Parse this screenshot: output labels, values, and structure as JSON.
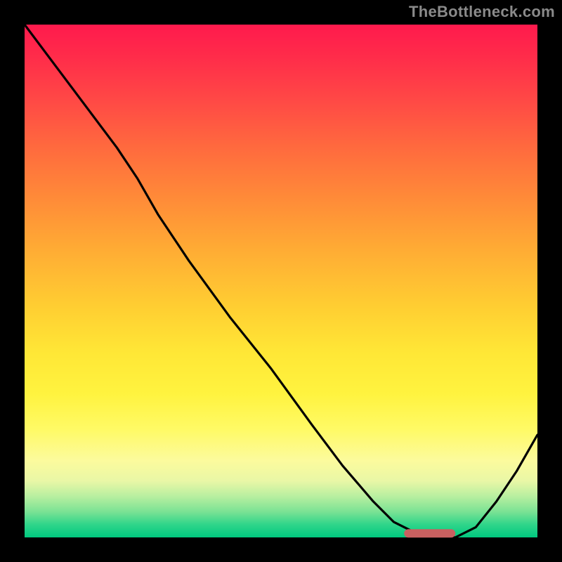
{
  "watermark": "TheBottleneck.com",
  "chart_data": {
    "type": "line",
    "title": "",
    "xlabel": "",
    "ylabel": "",
    "xlim": [
      0,
      100
    ],
    "ylim": [
      0,
      100
    ],
    "series": [
      {
        "name": "bottleneck-curve",
        "x": [
          0,
          6,
          12,
          18,
          22,
          26,
          32,
          40,
          48,
          56,
          62,
          68,
          72,
          76,
          80,
          84,
          88,
          92,
          96,
          100
        ],
        "values": [
          100,
          92,
          84,
          76,
          70,
          63,
          54,
          43,
          33,
          22,
          14,
          7,
          3,
          1,
          0,
          0,
          2,
          7,
          13,
          20
        ]
      }
    ],
    "annotations": [
      {
        "name": "optimal-zone-marker",
        "x_start": 74,
        "x_end": 84,
        "y": 0.8
      }
    ],
    "background_gradient": {
      "top": "#ff1a4d",
      "middle": "#ffe736",
      "bottom": "#00c97f"
    }
  }
}
